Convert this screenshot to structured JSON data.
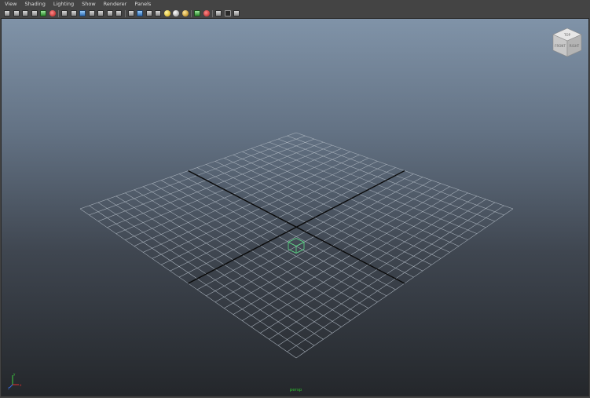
{
  "menu": {
    "items": [
      "View",
      "Shading",
      "Lighting",
      "Show",
      "Renderer",
      "Panels"
    ]
  },
  "toolbar": {
    "icons": [
      {
        "name": "select-camera-icon",
        "style": "gray"
      },
      {
        "name": "lock-camera-icon",
        "style": "gray"
      },
      {
        "name": "camera-attributes-icon",
        "style": "gray"
      },
      {
        "name": "bookmarks-icon",
        "style": "gray"
      },
      {
        "name": "image-plane-icon",
        "style": "green"
      },
      {
        "name": "2d-pan-zoom-icon",
        "style": "red"
      },
      {
        "sep": true
      },
      {
        "name": "grease-pencil-icon",
        "style": "gray"
      },
      {
        "name": "grid-icon",
        "style": "gray"
      },
      {
        "name": "film-gate-icon",
        "style": "blue"
      },
      {
        "name": "resolution-gate-icon",
        "style": "gray"
      },
      {
        "name": "gate-mask-icon",
        "style": "gray"
      },
      {
        "name": "field-chart-icon",
        "style": "gray"
      },
      {
        "name": "safe-action-icon",
        "style": "gray"
      },
      {
        "sep": true
      },
      {
        "name": "wireframe-icon",
        "style": "gray"
      },
      {
        "name": "smooth-shade-icon",
        "style": "blue"
      },
      {
        "name": "wireframe-on-shaded-icon",
        "style": "gray"
      },
      {
        "name": "textured-icon",
        "style": "gray"
      },
      {
        "name": "use-all-lights-icon",
        "style": "yellow"
      },
      {
        "name": "shadows-icon",
        "style": "silver"
      },
      {
        "name": "screen-space-ao-icon",
        "style": "gold"
      },
      {
        "sep": true
      },
      {
        "name": "motion-blur-icon",
        "style": "green"
      },
      {
        "name": "isolate-select-icon",
        "style": "red"
      },
      {
        "sep": true
      },
      {
        "name": "x-ray-icon",
        "style": "gray"
      },
      {
        "name": "x-ray-joints-icon",
        "style": "dark"
      },
      {
        "name": "backface-culling-icon",
        "style": "gray"
      }
    ]
  },
  "viewport": {
    "camera_label": "persp",
    "viewcube_faces": [
      "TOP",
      "FRONT",
      "RIGHT"
    ],
    "axis_labels": [
      "y",
      "x",
      "z"
    ],
    "colors": {
      "grid_line": "#a9b2bc",
      "axis_line": "#0a0a0a",
      "axis_y": "#3fd43f",
      "axis_x": "#e03030",
      "axis_z": "#3a6fe6",
      "camera_label": "#2fbf2f"
    }
  }
}
